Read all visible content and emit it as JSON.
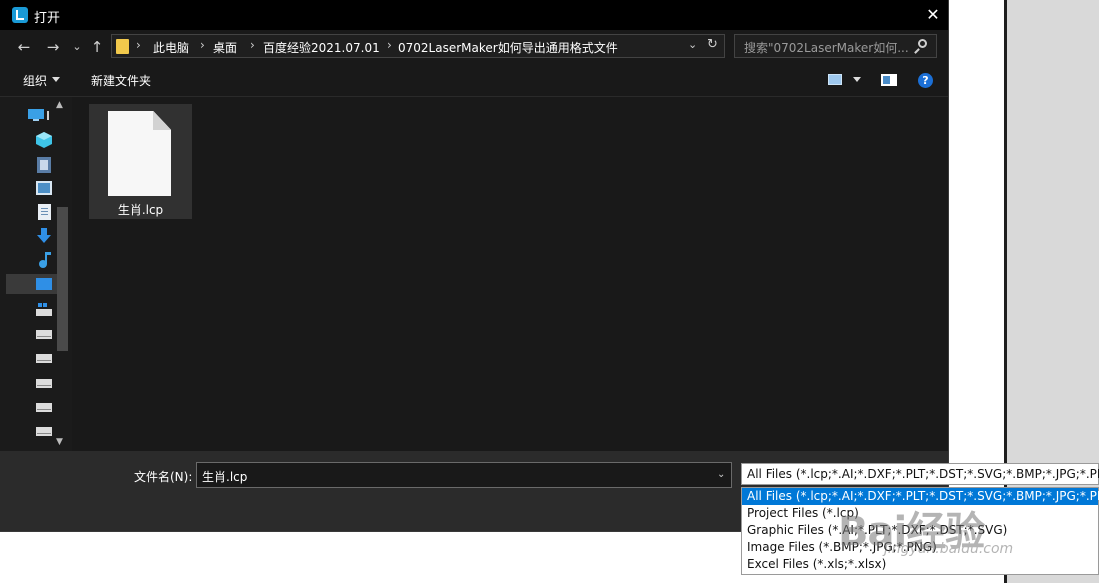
{
  "window": {
    "title": "打开"
  },
  "nav": {
    "back": "←",
    "forward": "→",
    "recent": "⌄",
    "up": "↑"
  },
  "breadcrumbs": [
    "此电脑",
    "桌面",
    "百度经验2021.07.01",
    "0702LaserMaker如何导出通用格式文件"
  ],
  "search": {
    "placeholder": "搜索\"0702LaserMaker如何..."
  },
  "toolbar": {
    "organize": "组织",
    "new_folder": "新建文件夹"
  },
  "files": [
    {
      "name": "生肖.lcp"
    }
  ],
  "bottom": {
    "filename_label": "文件名(N):",
    "filename_value": "生肖.lcp",
    "filetype_selected": "All Files  (*.lcp;*.AI;*.DXF;*.PLT;*.DST;*.SVG;*.BMP;*.JPG;*.PNG;*",
    "filetype_options": [
      "All Files  (*.lcp;*.AI;*.DXF;*.PLT;*.DST;*.SVG;*.BMP;*.JPG;*.PNG;*",
      "Project Files (*.lcp)",
      "Graphic Files  (*.AI;*.PLT;*.DXF;*.DST;*.SVG)",
      "Image Files  (*.BMP;*.JPG;*.PNG)",
      "Excel Files  (*.xls;*.xlsx)"
    ]
  },
  "watermark": {
    "text": "Bai经验",
    "sub": "jingyan.baidu.com"
  },
  "colors": {
    "accent": "#0078d7",
    "folder": "#f2c94c",
    "dialog_bg": "#191919"
  }
}
